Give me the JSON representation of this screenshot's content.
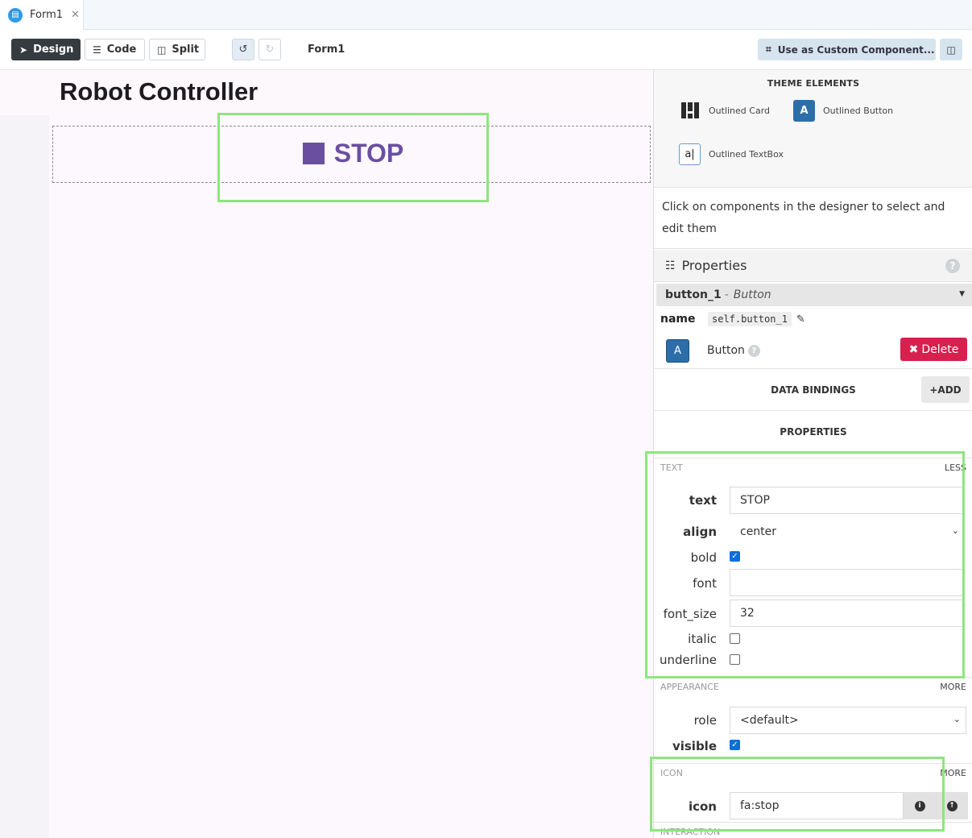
{
  "tab": {
    "label": "Form1",
    "close": "✕"
  },
  "toolbar": {
    "design_label": "Design",
    "code_label": "Code",
    "split_label": "Split",
    "form_name": "Form1",
    "custom_component_label": "Use as Custom Component..."
  },
  "canvas": {
    "title": "Robot Controller",
    "stop_button_text": "STOP",
    "stop_button_color": "#6a4fa0"
  },
  "theme_elements": {
    "title": "THEME ELEMENTS",
    "items": [
      {
        "label": "Outlined Card",
        "icon": "card-icon"
      },
      {
        "label": "Outlined Button",
        "icon": "button-icon",
        "glyph": "A"
      },
      {
        "label": "Outlined TextBox",
        "icon": "textbox-icon",
        "glyph": "a|"
      }
    ]
  },
  "hint": "Click on components in the designer to select and edit them",
  "properties_panel": {
    "title": "Properties",
    "component_name": "button_1",
    "component_type": "Button",
    "name_label": "name",
    "name_value": "self.button_1",
    "component_label": "Button",
    "component_glyph": "A",
    "delete_label": "Delete",
    "data_bindings_label": "DATA BINDINGS",
    "add_label": "ADD",
    "properties_label": "PROPERTIES"
  },
  "text_group": {
    "title": "TEXT",
    "toggle": "LESS",
    "text_label": "text",
    "text_value": "STOP",
    "align_label": "align",
    "align_value": "center",
    "bold_label": "bold",
    "bold_checked": true,
    "font_label": "font",
    "font_value": "",
    "font_size_label": "font_size",
    "font_size_value": "32",
    "italic_label": "italic",
    "italic_checked": false,
    "underline_label": "underline",
    "underline_checked": false
  },
  "appearance_group": {
    "title": "APPEARANCE",
    "toggle": "MORE",
    "role_label": "role",
    "role_value": "<default>",
    "visible_label": "visible",
    "visible_checked": true
  },
  "icon_group": {
    "title": "ICON",
    "toggle": "MORE",
    "icon_label": "icon",
    "icon_value": "fa:stop"
  },
  "interaction_group": {
    "title": "INTERACTION"
  },
  "colors": {
    "highlight": "#8ee57e",
    "delete": "#d6204d",
    "accent": "#2d6ea8"
  }
}
